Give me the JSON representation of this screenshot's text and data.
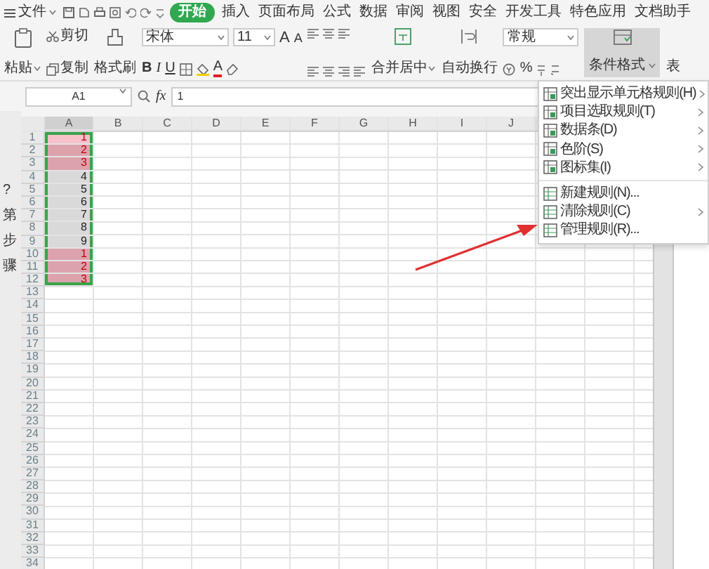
{
  "app_menu": {
    "label": "文件"
  },
  "tabs": [
    {
      "label": "开始",
      "selected": true
    },
    {
      "label": "插入",
      "selected": false
    },
    {
      "label": "页面布局",
      "selected": false
    },
    {
      "label": "公式",
      "selected": false
    },
    {
      "label": "数据",
      "selected": false
    },
    {
      "label": "审阅",
      "selected": false
    },
    {
      "label": "视图",
      "selected": false
    },
    {
      "label": "安全",
      "selected": false
    },
    {
      "label": "开发工具",
      "selected": false
    },
    {
      "label": "特色应用",
      "selected": false
    },
    {
      "label": "文档助手",
      "selected": false
    }
  ],
  "ribbon": {
    "paste": "粘贴",
    "cut": "剪切",
    "copy": "复制",
    "format_painter": "格式刷",
    "font_name": "宋体",
    "font_size": "11",
    "grow_font": "A",
    "shrink_font": "A",
    "bold": "B",
    "italic": "I",
    "underline": "U",
    "font_color": "A",
    "merge": "合并居中",
    "wrap": "自动换行",
    "number_format": "常规",
    "percent": "%",
    "conditional_format": {
      "label": "条件格式",
      "expanded": true
    },
    "cut_off_label": "表"
  },
  "formula_bar": {
    "name_box": "A1",
    "fx": "fx",
    "value": "1"
  },
  "side_fragments": [
    "?",
    "第",
    "步",
    "骤"
  ],
  "sheet": {
    "columns": [
      "A",
      "B",
      "C",
      "D",
      "E",
      "F",
      "G",
      "H",
      "I",
      "J"
    ],
    "row_numbers": [
      "1",
      "2",
      "3",
      "4",
      "5",
      "6",
      "7",
      "8",
      "9",
      "10",
      "11",
      "12",
      "13",
      "14",
      "15",
      "16",
      "17",
      "18",
      "19",
      "20",
      "21",
      "22",
      "23",
      "24",
      "25",
      "26",
      "27",
      "28",
      "29",
      "30",
      "31",
      "32",
      "33",
      "34"
    ],
    "column_a": [
      {
        "value": "1",
        "duplicate": true,
        "selected": true,
        "active": true
      },
      {
        "value": "2",
        "duplicate": true,
        "selected": true,
        "active": false
      },
      {
        "value": "3",
        "duplicate": true,
        "selected": true,
        "active": false
      },
      {
        "value": "4",
        "duplicate": false,
        "selected": true,
        "active": false
      },
      {
        "value": "5",
        "duplicate": false,
        "selected": true,
        "active": false
      },
      {
        "value": "6",
        "duplicate": false,
        "selected": true,
        "active": false
      },
      {
        "value": "7",
        "duplicate": false,
        "selected": true,
        "active": false
      },
      {
        "value": "8",
        "duplicate": false,
        "selected": true,
        "active": false
      },
      {
        "value": "9",
        "duplicate": false,
        "selected": true,
        "active": false
      },
      {
        "value": "1",
        "duplicate": true,
        "selected": true,
        "active": false
      },
      {
        "value": "2",
        "duplicate": true,
        "selected": true,
        "active": false
      },
      {
        "value": "3",
        "duplicate": true,
        "selected": true,
        "active": false
      }
    ]
  },
  "dropdown_menu": {
    "items": [
      {
        "label": "突出显示单元格规则(H)",
        "kind": "rule",
        "submenu": true
      },
      {
        "label": "项目选取规则(T)",
        "kind": "rule",
        "submenu": true
      },
      {
        "label": "数据条(D)",
        "kind": "rule",
        "submenu": true
      },
      {
        "label": "色阶(S)",
        "kind": "rule",
        "submenu": true
      },
      {
        "label": "图标集(I)",
        "kind": "rule",
        "submenu": true
      },
      {
        "label": "新建规则(N)...",
        "kind": "action",
        "submenu": false
      },
      {
        "label": "清除规则(C)",
        "kind": "action",
        "submenu": true
      },
      {
        "label": "管理规则(R)...",
        "kind": "action",
        "submenu": false
      }
    ]
  }
}
